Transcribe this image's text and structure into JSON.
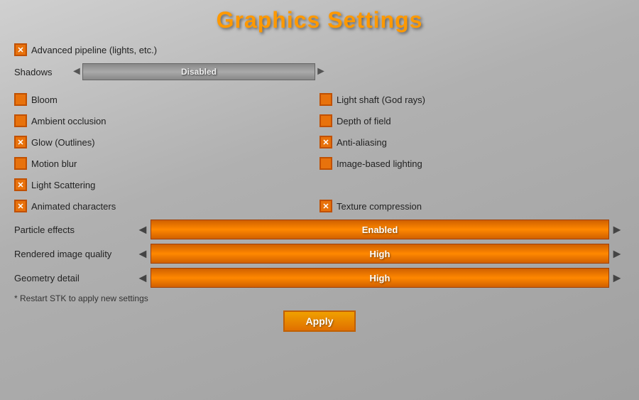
{
  "title": "Graphics Settings",
  "advanced_pipeline": {
    "label": "Advanced pipeline (lights, etc.)",
    "checked": true
  },
  "shadows": {
    "label": "Shadows",
    "value": "Disabled"
  },
  "checkboxes_left": [
    {
      "id": "bloom",
      "label": "Bloom",
      "checked": false
    },
    {
      "id": "ambient_occlusion",
      "label": "Ambient occlusion",
      "checked": false
    },
    {
      "id": "glow",
      "label": "Glow (Outlines)",
      "checked": true
    },
    {
      "id": "motion_blur",
      "label": "Motion blur",
      "checked": false
    },
    {
      "id": "light_scattering",
      "label": "Light Scattering",
      "checked": true
    }
  ],
  "checkboxes_right": [
    {
      "id": "light_shaft",
      "label": "Light shaft (God rays)",
      "checked": false
    },
    {
      "id": "depth_of_field",
      "label": "Depth of field",
      "checked": false
    },
    {
      "id": "anti_aliasing",
      "label": "Anti-aliasing",
      "checked": true
    },
    {
      "id": "image_based_lighting",
      "label": "Image-based lighting",
      "checked": false
    },
    {
      "id": "empty",
      "label": "",
      "checked": false
    }
  ],
  "bottom_checkboxes_left": {
    "label": "Animated characters",
    "checked": true
  },
  "bottom_checkboxes_right": {
    "label": "Texture compression",
    "checked": true
  },
  "sliders": [
    {
      "id": "particle_effects",
      "label": "Particle effects",
      "value": "Enabled"
    },
    {
      "id": "rendered_image_quality",
      "label": "Rendered image quality",
      "value": "High"
    },
    {
      "id": "geometry_detail",
      "label": "Geometry detail",
      "value": "High"
    }
  ],
  "restart_note": "* Restart STK to apply new settings",
  "apply_button": "Apply",
  "arrows": {
    "left": "◄",
    "right": "►"
  }
}
